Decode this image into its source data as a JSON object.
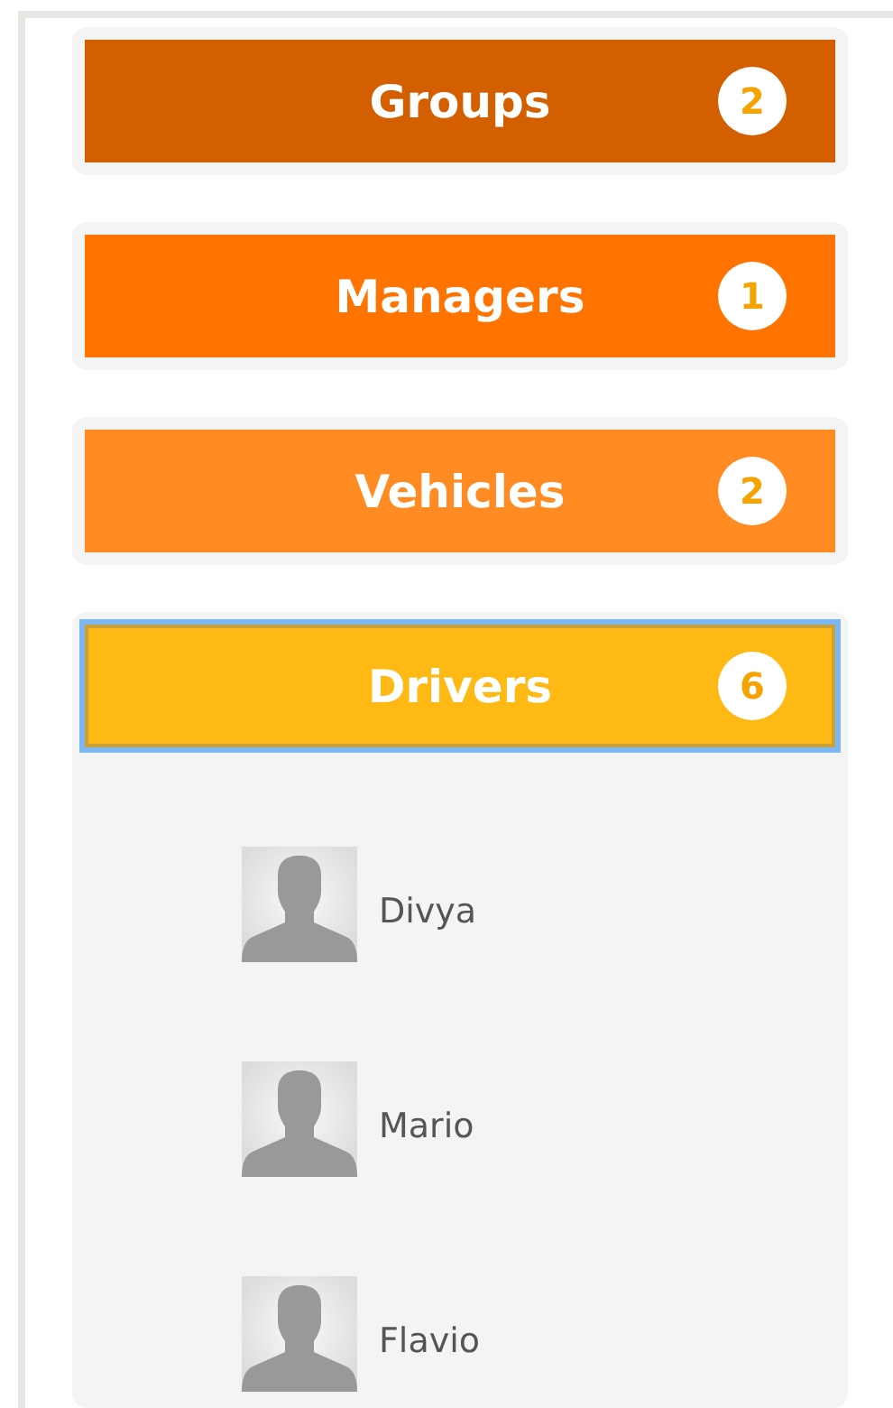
{
  "sections": [
    {
      "label": "Groups",
      "count": "2",
      "color": "#d35f00",
      "selected": false,
      "expanded": false
    },
    {
      "label": "Managers",
      "count": "1",
      "color": "#ff7300",
      "selected": false,
      "expanded": false
    },
    {
      "label": "Vehicles",
      "count": "2",
      "color": "#ff8b22",
      "selected": false,
      "expanded": false
    },
    {
      "label": "Drivers",
      "count": "6",
      "color": "#ffb914",
      "selected": true,
      "expanded": true,
      "items": [
        {
          "name": "Divya"
        },
        {
          "name": "Mario"
        },
        {
          "name": "Flavio"
        }
      ]
    }
  ]
}
